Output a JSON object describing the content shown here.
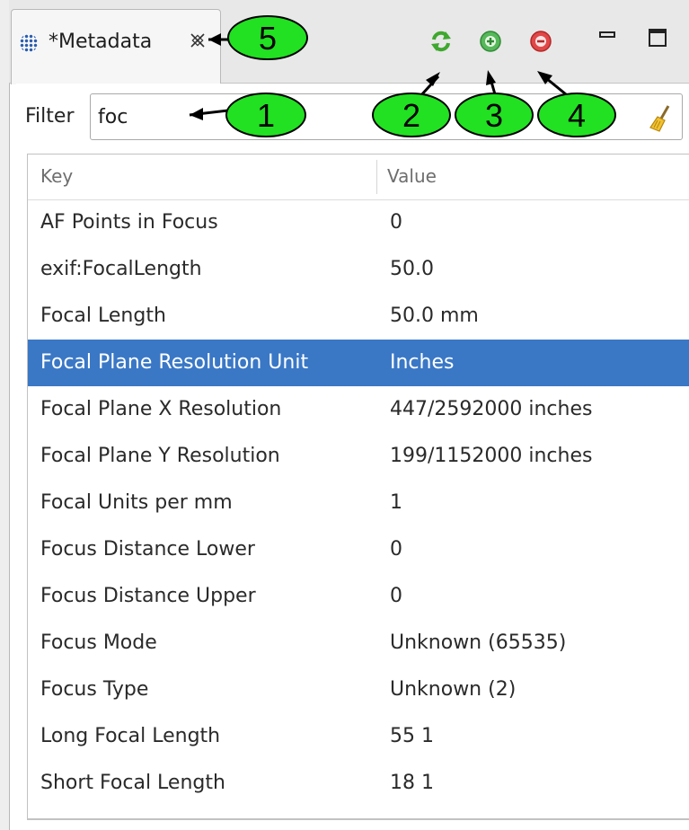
{
  "tab": {
    "title": "*Metadata",
    "close_icon": "close-icon",
    "icon": "grid-dots-icon"
  },
  "toolbar": {
    "refresh_icon": "refresh-icon",
    "add_icon": "plus-circle-icon",
    "remove_icon": "minus-circle-icon",
    "minimize_icon": "minimize-icon",
    "maximize_icon": "maximize-icon"
  },
  "filter": {
    "label": "Filter",
    "value": "foc",
    "clear_icon": "broom-icon"
  },
  "table": {
    "columns": {
      "key": "Key",
      "value": "Value"
    },
    "rows": [
      {
        "key": "AF Points in Focus",
        "value": "0"
      },
      {
        "key": "exif:FocalLength",
        "value": "50.0"
      },
      {
        "key": "Focal Length",
        "value": "50.0 mm"
      },
      {
        "key": "Focal Plane Resolution Unit",
        "value": "Inches",
        "selected": true
      },
      {
        "key": "Focal Plane X Resolution",
        "value": "447/2592000 inches"
      },
      {
        "key": "Focal Plane Y Resolution",
        "value": "199/1152000 inches"
      },
      {
        "key": "Focal Units per mm",
        "value": "1"
      },
      {
        "key": "Focus Distance Lower",
        "value": "0"
      },
      {
        "key": "Focus Distance Upper",
        "value": "0"
      },
      {
        "key": "Focus Mode",
        "value": "Unknown (65535)"
      },
      {
        "key": "Focus Type",
        "value": "Unknown (2)"
      },
      {
        "key": "Long Focal Length",
        "value": "55 1"
      },
      {
        "key": "Short Focal Length",
        "value": "18 1"
      }
    ]
  },
  "callouts": [
    {
      "label": "1"
    },
    {
      "label": "2"
    },
    {
      "label": "3"
    },
    {
      "label": "4"
    },
    {
      "label": "5"
    }
  ],
  "colors": {
    "selection": "#3a78c6",
    "callout_fill": "#22e022",
    "callout_stroke": "#000000"
  }
}
